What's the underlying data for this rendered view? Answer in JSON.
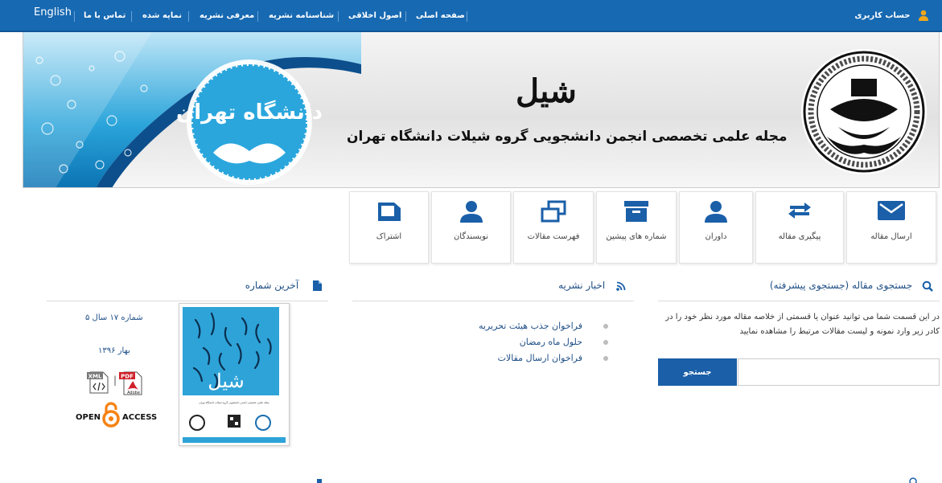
{
  "nav": {
    "english": "English",
    "items": [
      "تماس با ما",
      "نمایه شده",
      "معرفی نشریه",
      "شناسنامه نشریه",
      "اصول اخلاقی",
      "صفحه اصلی"
    ],
    "account": "حساب کاربری"
  },
  "banner": {
    "title": "شیل",
    "subtitle": "مجله علمی تخصصی انجمن دانشجویی گروه شیلات دانشگاه تهران",
    "logo_text": "دانشگاه تهران"
  },
  "tiles": [
    {
      "label": "ارسال مقاله",
      "icon": "envelope-icon"
    },
    {
      "label": "پیگیری مقاله",
      "icon": "refresh-arrows-icon"
    },
    {
      "label": "داوران",
      "icon": "user-icon"
    },
    {
      "label": "شماره های پیشین",
      "icon": "archive-box-icon"
    },
    {
      "label": "فهرست مقالات",
      "icon": "windows-stack-icon"
    },
    {
      "label": "نویسندگان",
      "icon": "user-icon"
    },
    {
      "label": "اشتراک",
      "icon": "folder-icon"
    }
  ],
  "search": {
    "heading": "جستجوی مقاله",
    "advanced": "(جستجوی پیشرفته)",
    "description": "در این قسمت شما می توانید عنوان یا قسمتی از خلاصه مقاله مورد نظر خود را در کادر زیر وارد نمونه و لیست مقالات مرتبط را مشاهده نمایید",
    "input_value": "",
    "button": "جستجو"
  },
  "news": {
    "heading": "اخبار نشریه",
    "items": [
      "فراخوان جذب هیئت تحریریه",
      "حلول ماه رمضان",
      "فراخوان ارسال مقالات"
    ]
  },
  "latest": {
    "heading": "آخرین شماره",
    "issue": "شماره ۱۷ سال ۵",
    "season": "بهار ۱۳۹۶",
    "xml": "XML",
    "pdf": "PDF",
    "adobe": "Adobe",
    "separator": "|",
    "open": "OPEN",
    "access": "ACCESS",
    "cover_title": "شیل",
    "cover_caption": "مجله علمی تخصصی انجمن دانشجویی گروه شیلات دانشگاه تهران"
  },
  "colors": {
    "nav": "#1769b2",
    "accent": "#1a5fa8",
    "link": "#1f4f86"
  }
}
